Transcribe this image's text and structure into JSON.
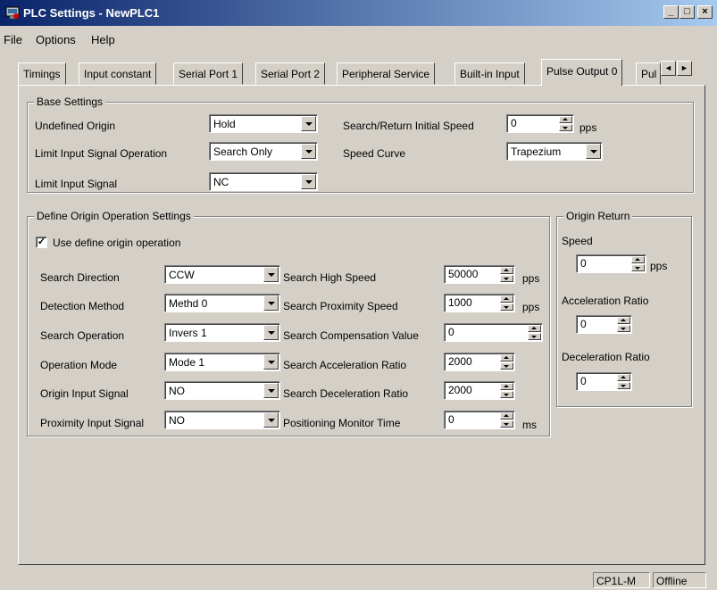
{
  "window": {
    "title": "PLC Settings - NewPLC1",
    "min": "_",
    "max": "□",
    "close": "×"
  },
  "menu": [
    "File",
    "Options",
    "Help"
  ],
  "tabs": [
    "Timings",
    "Input constant",
    "Serial Port 1",
    "Serial Port 2",
    "Peripheral Service",
    "Built-in Input",
    "Pulse Output 0",
    "Pul"
  ],
  "tab_scroll": {
    "left": "◄",
    "right": "►"
  },
  "base": {
    "title": "Base Settings",
    "undefined_origin_label": "Undefined Origin",
    "undefined_origin_value": "Hold",
    "limit_op_label": "Limit Input Signal Operation",
    "limit_op_value": "Search Only",
    "limit_signal_label": "Limit Input Signal",
    "limit_signal_value": "NC",
    "initial_speed_label": "Search/Return Initial Speed",
    "initial_speed_value": "0",
    "initial_speed_unit": "pps",
    "speed_curve_label": "Speed Curve",
    "speed_curve_value": "Trapezium"
  },
  "define": {
    "title": "Define Origin Operation Settings",
    "use_label": "Use define origin operation",
    "use_checked": "✓",
    "search_direction_label": "Search Direction",
    "search_direction_value": "CCW",
    "detection_label": "Detection Method",
    "detection_value": "Methd 0",
    "search_op_label": "Search Operation",
    "search_op_value": "Invers 1",
    "op_mode_label": "Operation Mode",
    "op_mode_value": "Mode 1",
    "origin_signal_label": "Origin Input Signal",
    "origin_signal_value": "NO",
    "prox_signal_label": "Proximity Input Signal",
    "prox_signal_value": "NO",
    "high_speed_label": "Search High Speed",
    "high_speed_value": "50000",
    "high_speed_unit": "pps",
    "prox_speed_label": "Search Proximity Speed",
    "prox_speed_value": "1000",
    "prox_speed_unit": "pps",
    "comp_label": "Search Compensation Value",
    "comp_value": "0",
    "accel_label": "Search Acceleration Ratio",
    "accel_value": "2000",
    "decel_label": "Search Deceleration Ratio",
    "decel_value": "2000",
    "monitor_label": "Positioning Monitor Time",
    "monitor_value": "0",
    "monitor_unit": "ms"
  },
  "origin_return": {
    "title": "Origin Return",
    "speed_label": "Speed",
    "speed_value": "0",
    "speed_unit": "pps",
    "accel_label": "Acceleration Ratio",
    "accel_value": "0",
    "decel_label": "Deceleration Ratio",
    "decel_value": "0"
  },
  "status": {
    "device": "CP1L-M",
    "mode": "Offline"
  }
}
